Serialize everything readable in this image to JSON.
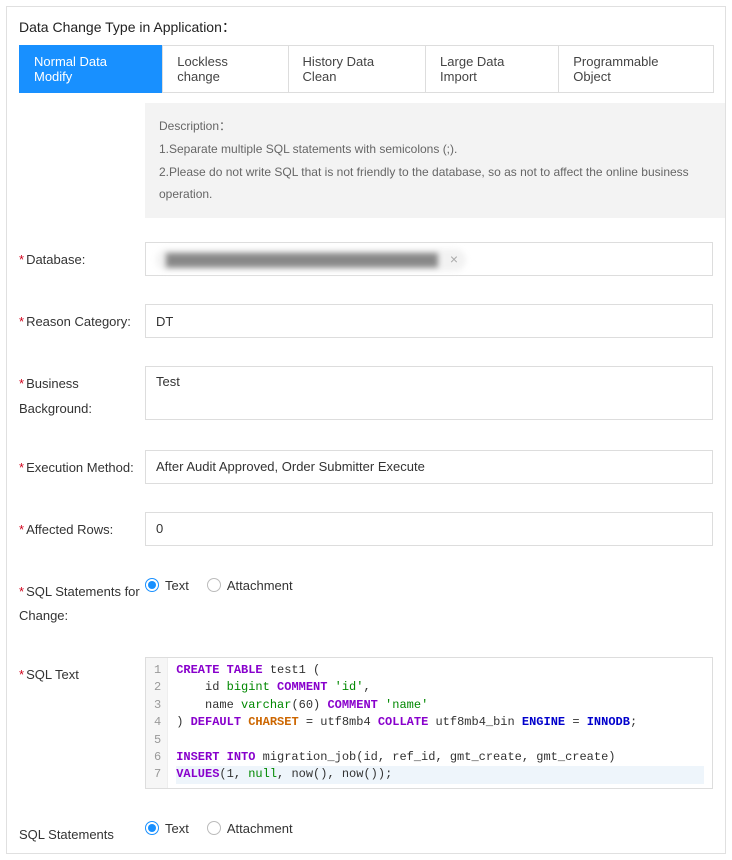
{
  "headerTitle": "Data Change Type in Application：",
  "tabs": [
    {
      "label": "Normal Data Modify",
      "active": true
    },
    {
      "label": "Lockless change",
      "active": false
    },
    {
      "label": "History Data Clean",
      "active": false
    },
    {
      "label": "Large Data Import",
      "active": false
    },
    {
      "label": "Programmable Object",
      "active": false
    }
  ],
  "description": {
    "title": "Description：",
    "line1": "1.Separate multiple SQL statements with semicolons (;).",
    "line2": "2.Please do not write SQL that is not friendly to the database, so as not to affect the online business operation."
  },
  "labels": {
    "database": "Database:",
    "reason": "Reason Category:",
    "business": "Business Background:",
    "execution": "Execution Method:",
    "affected": "Affected Rows:",
    "sqlChange": "SQL Statements for Change:",
    "sqlText": "SQL Text",
    "sqlRollback": "SQL Statements"
  },
  "values": {
    "database_masked": "████████████████████████████████",
    "reason": "DT",
    "business": "Test",
    "execution": "After Audit Approved, Order Submitter Execute",
    "affected": "0"
  },
  "radios": {
    "text": "Text",
    "attachment": "Attachment"
  },
  "sql": {
    "lines": [
      "1",
      "2",
      "3",
      "4",
      "5",
      "6",
      "7"
    ],
    "l1_a": "CREATE TABLE",
    "l1_b": " test1 (",
    "l2_a": "    id ",
    "l2_b": "bigint",
    "l2_c": " COMMENT",
    "l2_d": " 'id'",
    "l2_e": ",",
    "l3_a": "    name ",
    "l3_b": "varchar",
    "l3_c": "(60)",
    "l3_d": " COMMENT",
    "l3_e": " 'name'",
    "l4_a": ") ",
    "l4_b": "DEFAULT",
    "l4_c": " CHARSET",
    "l4_d": " = utf8mb4 ",
    "l4_e": "COLLATE",
    "l4_f": " utf8mb4_bin ",
    "l4_g": "ENGINE",
    "l4_h": " = ",
    "l4_i": "INNODB",
    "l4_j": ";",
    "l6_a": "INSERT INTO",
    "l6_b": " migration_job(id, ref_id, gmt_create, gmt_create)",
    "l7_a": "VALUES",
    "l7_b": "(1, ",
    "l7_c": "null",
    "l7_d": ", now(), now());"
  }
}
